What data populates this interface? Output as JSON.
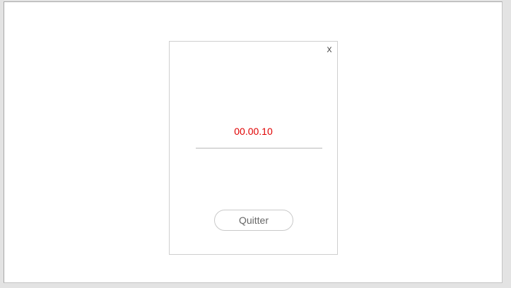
{
  "dialog": {
    "close_label": "x",
    "timer": "00.00.10",
    "quit_label": "Quitter"
  },
  "colors": {
    "timer": "#e00000",
    "border": "#cfcfcf",
    "background": "#ffffff"
  }
}
